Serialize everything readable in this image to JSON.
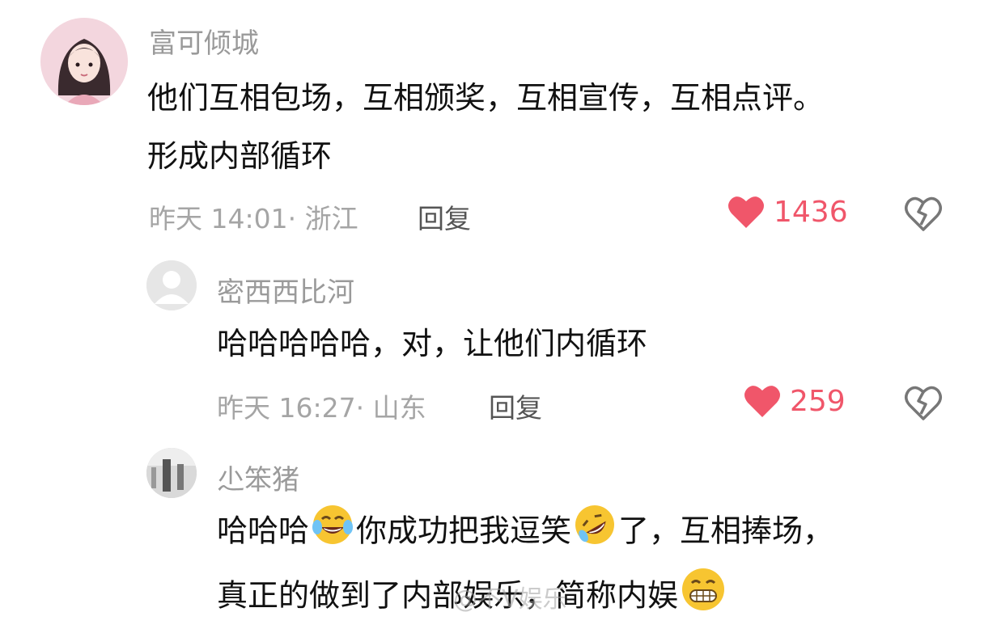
{
  "colors": {
    "like": "#f0566a",
    "username": "#9a9a9a",
    "meta": "#a5a5a5"
  },
  "comments": [
    {
      "username": "富可倾城",
      "avatar": "anime-girl-avatar",
      "lines": [
        "他们互相包场，互相颁奖，互相宣传，互相点评。",
        "形成内部循环"
      ],
      "meta": "昨天 14:01· 浙江",
      "reply": "回复",
      "likes": "1436"
    },
    {
      "username": "密西西比河",
      "avatar": "default-user-avatar",
      "lines": [
        "哈哈哈哈哈，对，让他们内循环"
      ],
      "meta": "昨天 16:27· 山东",
      "reply": "回复",
      "likes": "259"
    },
    {
      "username": "尐笨猪",
      "avatar": "photo-avatar",
      "line1_parts": [
        "哈哈哈",
        "你成功把我逗笑",
        "了，互相捧场，"
      ],
      "line2_parts": [
        "真正的做到了内部娱乐，简称内娱"
      ],
      "emojis": [
        "tears-of-joy-emoji",
        "rofl-emoji",
        "grin-emoji"
      ]
    }
  ],
  "watermark": "@不V娱乐"
}
